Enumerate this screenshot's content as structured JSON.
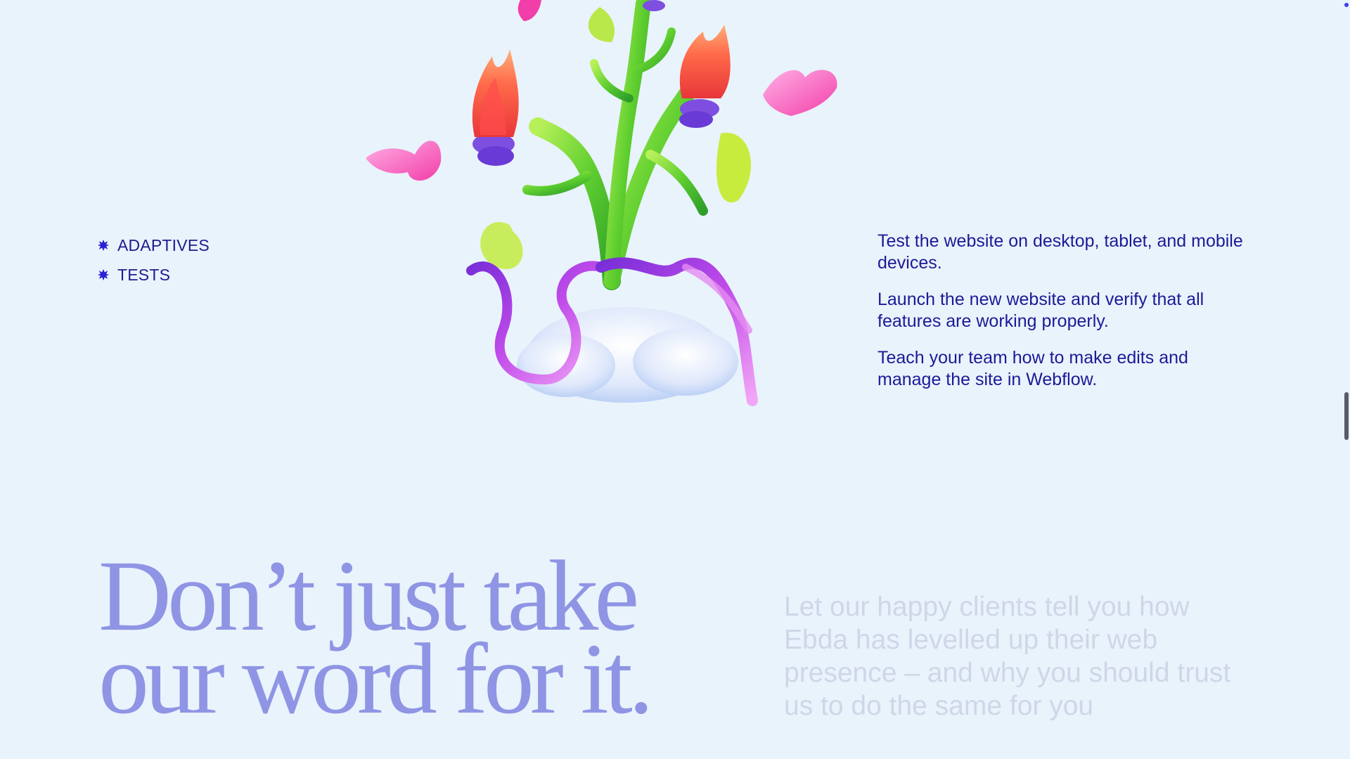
{
  "tags": [
    {
      "label": "ADAPTIVES",
      "icon": "asterisk-bullet-icon"
    },
    {
      "label": "TESTS",
      "icon": "asterisk-bullet-icon"
    }
  ],
  "steps": [
    "Test the website on desktop, tablet, and mobile devices.",
    "Launch the new website and verify that all features are working properly.",
    "Teach your team how to make edits and manage the site in Webflow."
  ],
  "testimonials": {
    "headline_line1": "Don’t just take",
    "headline_line2": "our word for it.",
    "intro": "Let our happy clients tell you how Ebda has levelled up their web presence – and why you should trust us to do the same for you"
  },
  "colors": {
    "background": "#e9f3fc",
    "text_primary": "#1b1b96",
    "headline": "#8f95e4",
    "faded_text": "#cfd6e7",
    "bullet": "#2a21d4"
  }
}
